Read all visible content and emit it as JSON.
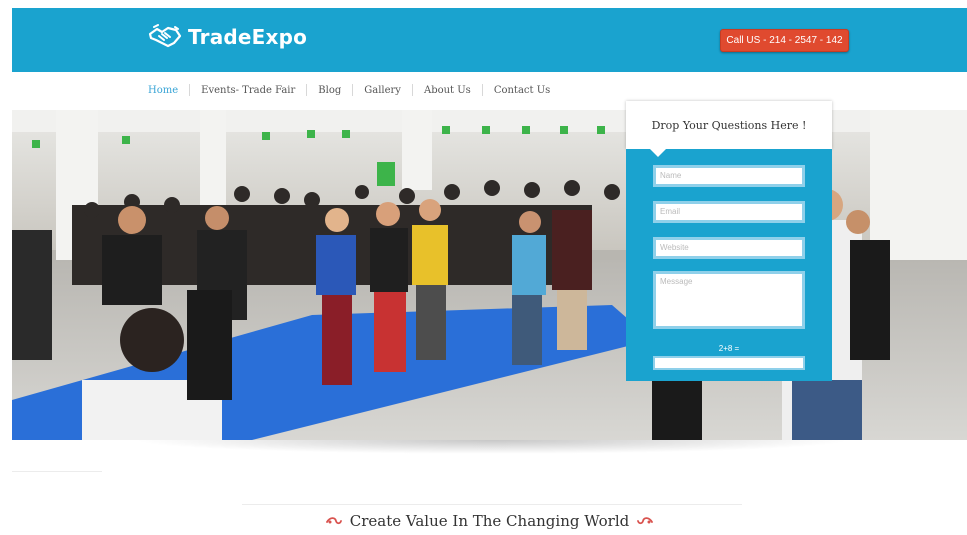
{
  "brand": {
    "name": "TradeExpo",
    "logo_icon": "handshake-icon"
  },
  "header": {
    "call_label": "Call US - 214 - 2547 - 142"
  },
  "nav": {
    "items": [
      {
        "label": "Home",
        "active": true
      },
      {
        "label": "Events- Trade Fair",
        "active": false
      },
      {
        "label": "Blog",
        "active": false
      },
      {
        "label": "Gallery",
        "active": false
      },
      {
        "label": "About Us",
        "active": false
      },
      {
        "label": "Contact Us",
        "active": false
      }
    ]
  },
  "form": {
    "title": "Drop Your Questions Here !",
    "name_placeholder": "Name",
    "email_placeholder": "Email",
    "website_placeholder": "Website",
    "message_placeholder": "Message",
    "captcha_label": "2+8 ="
  },
  "tagline": {
    "text": "Create Value In The Changing World",
    "ornament_icon": "swirl-ornament-icon"
  },
  "colors": {
    "brand": "#1aa3cf",
    "call_button": "#e04a2f",
    "nav_active": "#3aa5d6",
    "carpet": "#2a6fd8"
  }
}
